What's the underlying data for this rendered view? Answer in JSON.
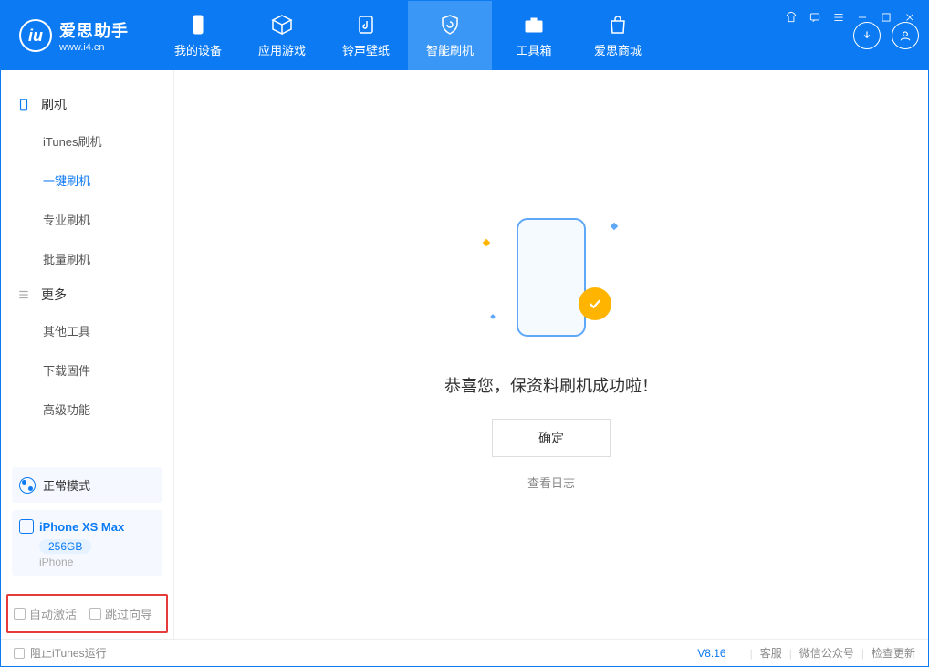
{
  "brand": {
    "title": "爱思助手",
    "subtitle": "www.i4.cn"
  },
  "nav": {
    "items": [
      {
        "label": "我的设备"
      },
      {
        "label": "应用游戏"
      },
      {
        "label": "铃声壁纸"
      },
      {
        "label": "智能刷机"
      },
      {
        "label": "工具箱"
      },
      {
        "label": "爱思商城"
      }
    ]
  },
  "sidebar": {
    "section_flash": "刷机",
    "flash_items": [
      "iTunes刷机",
      "一键刷机",
      "专业刷机",
      "批量刷机"
    ],
    "section_more": "更多",
    "more_items": [
      "其他工具",
      "下载固件",
      "高级功能"
    ]
  },
  "device": {
    "mode": "正常模式",
    "name": "iPhone XS Max",
    "capacity": "256GB",
    "type": "iPhone"
  },
  "options": {
    "auto_activate": "自动激活",
    "skip_guide": "跳过向导"
  },
  "main": {
    "success_text": "恭喜您，保资料刷机成功啦！",
    "ok_button": "确定",
    "view_log": "查看日志"
  },
  "footer": {
    "block_itunes": "阻止iTunes运行",
    "version": "V8.16",
    "service": "客服",
    "wechat": "微信公众号",
    "check_update": "检查更新"
  }
}
